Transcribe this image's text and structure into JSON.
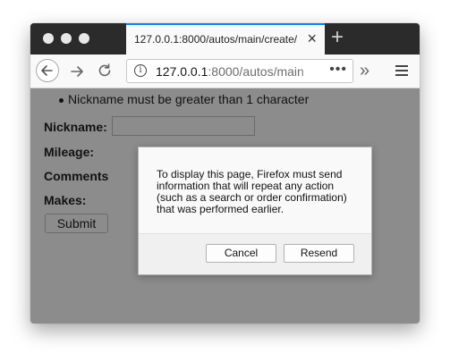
{
  "browser": {
    "tab_title": "127.0.0.1:8000/autos/main/create/",
    "close_glyph": "×",
    "new_tab_glyph": "+",
    "url_host": "127.0.0.1",
    "url_path": ":8000/autos/main",
    "url_more": "•••",
    "overflow_glyph": "»",
    "info_glyph": "i",
    "accent_color": "#0a84ff"
  },
  "page": {
    "error_message": "Nickname must be greater than 1 character",
    "fields": {
      "nickname_label": "Nickname:",
      "mileage_label": "Mileage:",
      "comments_label": "Comments",
      "makes_label": "Makes:"
    },
    "submit_label": "Submit"
  },
  "dialog": {
    "message": "To display this page, Firefox must send information that will repeat any action (such as a search or order confirmation) that was performed earlier.",
    "cancel_label": "Cancel",
    "resend_label": "Resend"
  },
  "icons": {
    "back": "arrow-left-icon",
    "forward": "arrow-right-icon",
    "reload": "reload-icon",
    "info": "info-icon",
    "menu": "hamburger-menu-icon"
  }
}
